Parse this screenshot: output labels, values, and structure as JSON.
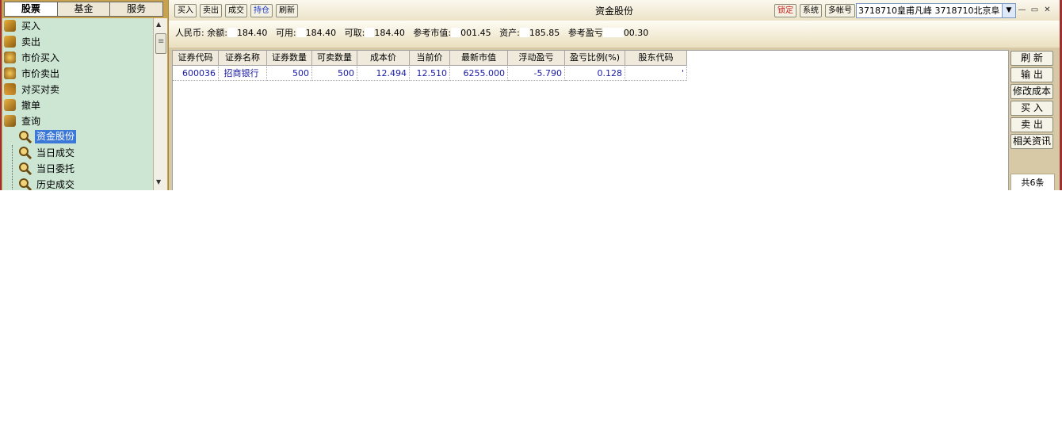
{
  "left_panel": {
    "tabs": [
      {
        "label": "股票",
        "active": true
      },
      {
        "label": "基金",
        "active": false
      },
      {
        "label": "服务",
        "active": false
      }
    ],
    "tree": [
      {
        "label": "买入",
        "icon": "buy-icon",
        "level": 0
      },
      {
        "label": "卖出",
        "icon": "sell-icon",
        "level": 0
      },
      {
        "label": "市价买入",
        "icon": "market-buy-icon",
        "level": 0
      },
      {
        "label": "市价卖出",
        "icon": "market-sell-icon",
        "level": 0
      },
      {
        "label": "对买对卖",
        "icon": "swap-icon",
        "level": 0
      },
      {
        "label": "撤单",
        "icon": "cancel-order-icon",
        "level": 0
      },
      {
        "label": "查询",
        "icon": "query-icon",
        "level": 0
      },
      {
        "label": "资金股份",
        "icon": "magnifier-icon",
        "level": 1,
        "selected": true
      },
      {
        "label": "当日成交",
        "icon": "magnifier-icon",
        "level": 1
      },
      {
        "label": "当日委托",
        "icon": "magnifier-icon",
        "level": 1
      },
      {
        "label": "历史成交",
        "icon": "magnifier-icon",
        "level": 1
      }
    ]
  },
  "toolbar": {
    "buttons": [
      {
        "label": "买入",
        "active": false
      },
      {
        "label": "卖出",
        "active": false
      },
      {
        "label": "成交",
        "active": false
      },
      {
        "label": "持仓",
        "active": true
      },
      {
        "label": "刷新",
        "active": false
      }
    ],
    "title": "资金股份",
    "lock_label": "锁定",
    "system_label": "系统",
    "multi_account_label": "多帐号",
    "account_value": "3718710皇甫凡峰  3718710北京阜",
    "window_controls": [
      "minimize-icon",
      "restore-icon",
      "close-icon"
    ]
  },
  "summary": {
    "currency": "人民币:",
    "balance_label": "余额:",
    "balance_value": "184.40",
    "available_label": "可用:",
    "available_value": "184.40",
    "withdrawable_label": "可取:",
    "withdrawable_value": "184.40",
    "market_value_label": "参考市值:",
    "market_value_value": "001.45",
    "assets_label": "资产:",
    "assets_value": "185.85",
    "profit_label": "参考盈亏",
    "profit_value": "00.30"
  },
  "grid": {
    "columns": [
      "证券代码",
      "证券名称",
      "证券数量",
      "可卖数量",
      "成本价",
      "当前价",
      "最新市值",
      "浮动盈亏",
      "盈亏比例(%)",
      "股东代码"
    ],
    "rows": [
      [
        "600036",
        "招商银行",
        "500",
        "500",
        "12.494",
        "12.510",
        "6255.000",
        "-5.790",
        "0.128",
        "'"
      ]
    ]
  },
  "side_buttons": [
    "刷 新",
    "输 出",
    "修改成本",
    "买 入",
    "卖 出",
    "相关资讯"
  ],
  "record_count": "共6条"
}
